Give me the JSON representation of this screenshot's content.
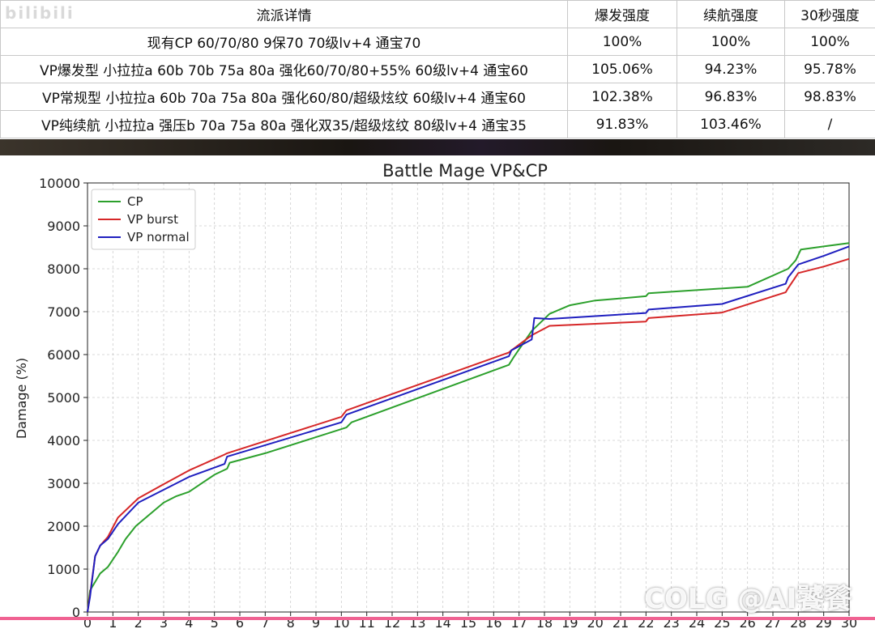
{
  "table": {
    "headers": [
      "流派详情",
      "爆发强度",
      "续航强度",
      "30秒强度"
    ],
    "rows": [
      [
        "现有CP 60/70/80 9保70 70级lv+4 通宝70",
        "100%",
        "100%",
        "100%"
      ],
      [
        "VP爆发型 小拉拉a 60b 70b 75a 80a 强化60/70/80+55% 60级lv+4 通宝60",
        "105.06%",
        "94.23%",
        "95.78%"
      ],
      [
        "VP常规型 小拉拉a 60b 70a 75a 80a 强化60/80/超级炫纹 60级lv+4 通宝60",
        "102.38%",
        "96.83%",
        "98.83%"
      ],
      [
        "VP纯续航 小拉拉a 强压b 70a 75a 80a 强化双35/超级炫纹 80级lv+4 通宝35",
        "91.83%",
        "103.46%",
        "/"
      ]
    ]
  },
  "watermark_top": "bilibili",
  "watermark_brand": "COLG @AI饕餮",
  "colors": {
    "cp": "#2ca02c",
    "vp_burst": "#d62728",
    "vp_normal": "#1f1fbf",
    "grid": "#cccccc",
    "accent_bar": "#f06292"
  },
  "chart_data": {
    "type": "line",
    "title": "Battle Mage VP&CP",
    "xlabel": "",
    "ylabel": "Damage (%)",
    "xlim": [
      0,
      30
    ],
    "ylim": [
      0,
      10000
    ],
    "xticks": [
      0,
      1,
      2,
      3,
      4,
      5,
      6,
      7,
      8,
      9,
      10,
      11,
      12,
      13,
      14,
      15,
      16,
      17,
      18,
      19,
      20,
      21,
      22,
      23,
      24,
      25,
      26,
      27,
      28,
      29,
      30
    ],
    "yticks": [
      0,
      1000,
      2000,
      3000,
      4000,
      5000,
      6000,
      7000,
      8000,
      9000,
      10000
    ],
    "grid": true,
    "legend": "top-left",
    "series": [
      {
        "name": "CP",
        "color": "#2ca02c",
        "x": [
          0,
          0.1,
          0.5,
          0.8,
          1.2,
          1.5,
          1.9,
          2.5,
          3.0,
          3.5,
          4.0,
          5.0,
          5.5,
          5.6,
          7.0,
          10.2,
          10.4,
          16.6,
          16.8,
          17.5,
          18.2,
          19.0,
          20.0,
          21.0,
          22.0,
          22.1,
          26.0,
          27.6,
          27.9,
          28.1,
          29.0,
          30.0
        ],
        "y": [
          0,
          500,
          900,
          1050,
          1400,
          1700,
          2000,
          2300,
          2550,
          2700,
          2800,
          3200,
          3340,
          3480,
          3700,
          4300,
          4420,
          5760,
          5950,
          6550,
          6950,
          7150,
          7260,
          7310,
          7360,
          7430,
          7580,
          8000,
          8200,
          8450,
          8520,
          8600
        ]
      },
      {
        "name": "VP burst",
        "color": "#d62728",
        "x": [
          0,
          0.1,
          0.3,
          0.5,
          0.8,
          1.2,
          2.0,
          3.0,
          4.0,
          5.4,
          5.5,
          10.0,
          10.2,
          16.6,
          16.7,
          17.5,
          18.2,
          22.0,
          22.1,
          25.0,
          27.5,
          27.6,
          28.0,
          29.0,
          30.0
        ],
        "y": [
          0,
          400,
          1300,
          1550,
          1750,
          2200,
          2650,
          2980,
          3300,
          3670,
          3700,
          4550,
          4700,
          6050,
          6100,
          6450,
          6670,
          6770,
          6850,
          6980,
          7450,
          7550,
          7900,
          8050,
          8230
        ]
      },
      {
        "name": "VP normal",
        "color": "#1f1fbf",
        "x": [
          0,
          0.1,
          0.3,
          0.5,
          0.8,
          1.2,
          2.0,
          3.0,
          4.0,
          5.4,
          5.5,
          10.0,
          10.2,
          16.6,
          16.7,
          17.5,
          17.6,
          18.2,
          22.0,
          22.1,
          25.0,
          27.5,
          27.6,
          28.0,
          29.0,
          30.0
        ],
        "y": [
          0,
          350,
          1300,
          1550,
          1700,
          2050,
          2550,
          2850,
          3150,
          3450,
          3620,
          4420,
          4600,
          5960,
          6100,
          6350,
          6850,
          6830,
          6970,
          7050,
          7180,
          7650,
          7800,
          8100,
          8300,
          8520
        ]
      }
    ]
  }
}
